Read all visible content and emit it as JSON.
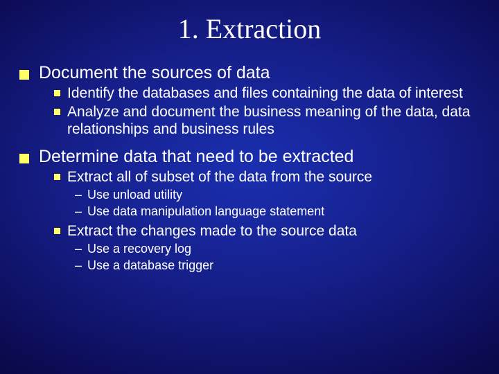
{
  "slide": {
    "title": "1. Extraction",
    "b1": {
      "text": "Document the sources of data",
      "s1": "Identify the databases and files containing the data of interest",
      "s2": "Analyze and document the business meaning of the data, data relationships and business rules"
    },
    "b2": {
      "text": "Determine data that need to be extracted",
      "s1": "Extract all of subset of the data from the source",
      "s1a": "Use unload utility",
      "s1b": "Use data manipulation language statement",
      "s2": "Extract the changes made to the source data",
      "s2a": "Use a recovery log",
      "s2b": "Use a database trigger"
    }
  }
}
